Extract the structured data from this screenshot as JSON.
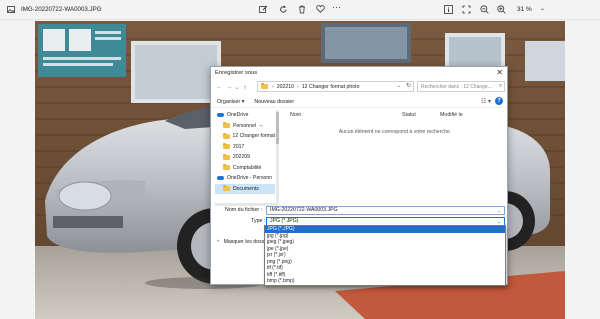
{
  "viewer": {
    "filename": "IMG-20220722-WA0003.JPG",
    "zoom": "31 %"
  },
  "dialog": {
    "title": "Enregistrer sous",
    "close": "✕",
    "address": {
      "root": "202210",
      "folder": "12 Changer format photo"
    },
    "search_placeholder": "Rechercher dans : 12 Change...",
    "organize": "Organiser ▾",
    "new_folder": "Nouveau dossier",
    "help": "?",
    "nav_items": [
      {
        "label": "OneDrive",
        "type": "cloud"
      },
      {
        "label": "Personnel",
        "type": "folder"
      },
      {
        "label": "12 Changer format",
        "type": "folder"
      },
      {
        "label": "2017",
        "type": "folder"
      },
      {
        "label": "202209",
        "type": "folder"
      },
      {
        "label": "Comptabilité",
        "type": "folder"
      },
      {
        "label": "OneDrive - Personn",
        "type": "cloud"
      },
      {
        "label": "Documents",
        "type": "folder"
      }
    ],
    "columns": {
      "name": "Nom",
      "status": "Statut",
      "modified": "Modifié le"
    },
    "empty_message": "Aucun élément ne correspond à votre recherche.",
    "filename_label": "Nom du fichier :",
    "filename_value": "IMG-20220722-WA0003.JPG",
    "type_label": "Type :",
    "type_value": "JPG (*.JPG)",
    "hide_folders": "Masquer les dossiers",
    "type_options": [
      "JPG (*.JPG)",
      "jpg (*.jpg)",
      "jpeg (*.jpeg)",
      "jpe (*.jpe)",
      "jxr (*.jxr)",
      "png (*.png)",
      "tif (*.tif)",
      "tiff (*.tiff)",
      "bmp (*.bmp)"
    ]
  }
}
